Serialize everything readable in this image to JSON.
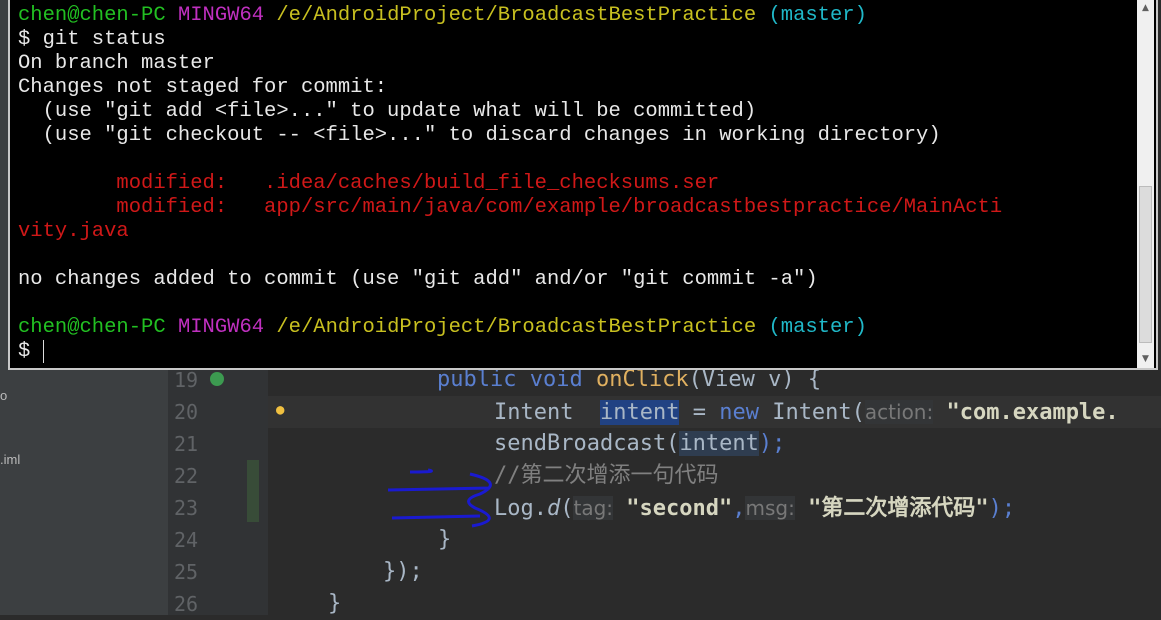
{
  "sidebar": {
    "fragments": [
      "o",
      ".iml"
    ]
  },
  "terminal": {
    "lines": [
      {
        "user": "chen@chen-PC",
        "env": "MINGW64",
        "path": "/e/AndroidProject/BroadcastBestPractice",
        "branch": "(master)"
      },
      "$ git status",
      "On branch master",
      "Changes not staged for commit:",
      "  (use \"git add <file>...\" to update what will be committed)",
      "  (use \"git checkout -- <file>...\" to discard changes in working directory)",
      "",
      "        modified:   .idea/caches/build_file_checksums.ser",
      "        modified:   app/src/main/java/com/example/broadcastbestpractice/MainActi",
      "vity.java",
      "",
      "no changes added to commit (use \"git add\" and/or \"git commit -a\")",
      "",
      {
        "user": "chen@chen-PC",
        "env": "MINGW64",
        "path": "/e/AndroidProject/BroadcastBestPractice",
        "branch": "(master)"
      },
      "$ "
    ]
  },
  "editor": {
    "line_numbers": [
      "19",
      "20",
      "21",
      "22",
      "23",
      "24",
      "25",
      "26"
    ],
    "code": {
      "l19": {
        "kw": "public void",
        "fn": "onClick",
        "rest": "(View v) {"
      },
      "l20": {
        "a": "Intent  ",
        "var": "intent",
        "b": " = ",
        "kw": "new",
        "c": " Intent(",
        "hint": "action:",
        "str": "\"com.example."
      },
      "l21": {
        "a": "sendBroadcast(",
        "var": "intent",
        "b": ");"
      },
      "l22": "//第二次增添一句代码",
      "l23": {
        "a": "Log.",
        "fn": "d",
        "b": "(",
        "hint1": "tag:",
        "str1": "\"second\"",
        "comma": ",",
        "hint2": "msg:",
        "str2": "\"第二次增添代码\"",
        "c": ");"
      },
      "l24": "}",
      "l25": "});",
      "l26": "}"
    }
  },
  "colors": {
    "terminal_bg": "#000000",
    "user": "#22c022",
    "env": "#c030c0",
    "path": "#c8c020",
    "branch": "#20b8c8",
    "modified": "#d01818",
    "editor_bg": "#2b2b2b",
    "annotation": "#1a1ad0"
  }
}
